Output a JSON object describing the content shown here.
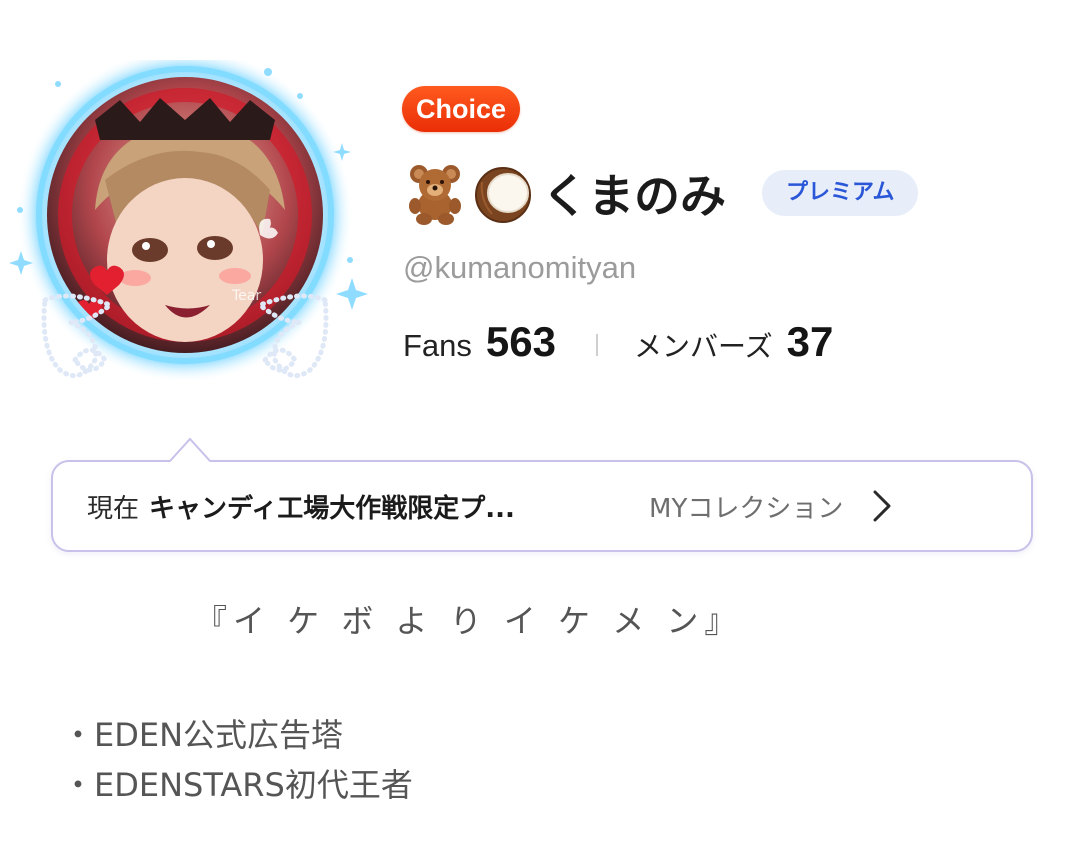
{
  "profile": {
    "badge_label": "Choice",
    "emoji_icons": [
      "teddy-bear-icon",
      "coconut-icon"
    ],
    "display_name": "くまのみ",
    "premium_label": "プレミアム",
    "handle": "@kumanomityan",
    "avatar_watermark": "Tear"
  },
  "stats": {
    "fans_label": "Fans",
    "fans_value": "563",
    "members_label": "メンバーズ",
    "members_value": "37"
  },
  "collection": {
    "prefix": "現在",
    "name": "キャンディ工場大作戦限定プ...",
    "link_label": "MYコレクション"
  },
  "bio": {
    "quote": "『イ ケ ボ よ り イ ケ メ ン』",
    "lines": [
      "・EDEN公式広告塔",
      "・EDENSTARS初代王者"
    ]
  },
  "colors": {
    "choice_badge": "#ea2e06",
    "premium_text": "#2a56d8",
    "premium_bg": "#e7edf9",
    "collection_border": "#c9c1ea",
    "avatar_glow": "#59c8ff"
  }
}
